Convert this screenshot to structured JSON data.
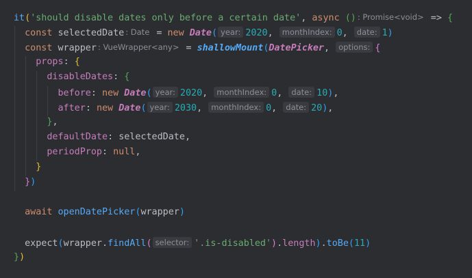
{
  "code": {
    "it_fn": "it",
    "test_name": "'should disable dates only before a certain date'",
    "async_kw": "async",
    "return_type_hint": ": Promise<void>",
    "arrow": "=>",
    "const_kw": "const",
    "new_kw": "new",
    "await_kw": "await",
    "null_kw": "null",
    "selected_date_var": "selectedDate",
    "selected_date_type_hint": ": Date",
    "date_class": "Date",
    "year_hint": "year:",
    "month_hint": "monthIndex:",
    "date_hint": "date:",
    "selected_year": "2020",
    "selected_month": "0",
    "selected_day": "1",
    "wrapper_var": "wrapper",
    "wrapper_type_hint": ": VueWrapper<any>",
    "shallow_mount_fn": "shallowMount",
    "date_picker_cls": "DatePicker",
    "options_hint": "options:",
    "props_key": "props",
    "disable_dates_key": "disableDates",
    "before_key": "before",
    "before_year": "2020",
    "before_month": "0",
    "before_day": "10",
    "after_key": "after",
    "after_year": "2030",
    "after_month": "0",
    "after_day": "20",
    "default_date_key": "defaultDate",
    "period_prop_key": "periodProp",
    "open_fn": "openDatePicker",
    "expect_fn": "expect",
    "find_all_fn": "findAll",
    "selector_hint": "selector:",
    "selector_value": "'.is-disabled'",
    "length_prop": "length",
    "to_be_fn": "toBe",
    "expected_count": "11"
  }
}
